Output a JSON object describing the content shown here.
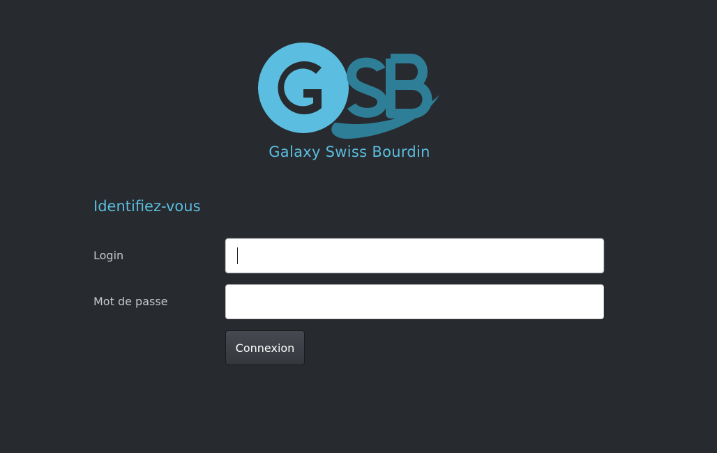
{
  "brand": {
    "logo_letters": "GSB",
    "name": "Galaxy Swiss Bourdin",
    "colors": {
      "light_blue": "#5bbddf",
      "dark_blue": "#2e7e97",
      "background": "#272a2e"
    }
  },
  "login_form": {
    "title": "Identifiez-vous",
    "login_label": "Login",
    "login_value": "",
    "password_label": "Mot de passe",
    "password_value": "",
    "submit_label": "Connexion"
  }
}
